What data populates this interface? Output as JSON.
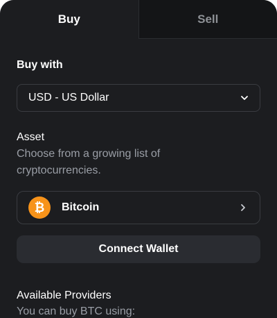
{
  "tabs": {
    "buy": "Buy",
    "sell": "Sell",
    "active": "buy"
  },
  "buy_with": {
    "label": "Buy with",
    "selected": "USD - US Dollar",
    "chevron_icon": "chevron-down-icon"
  },
  "asset": {
    "heading": "Asset",
    "description": "Choose from a growing list of cryptocurrencies.",
    "selected_name": "Bitcoin",
    "coin_icon": "bitcoin-icon",
    "coin_symbol": "₿",
    "coin_color": "#f7931a",
    "chevron_icon": "chevron-right-icon"
  },
  "connect_wallet": {
    "label": "Connect Wallet"
  },
  "providers": {
    "heading": "Available Providers",
    "description": "You can buy BTC using:"
  },
  "colors": {
    "background": "#1c1d20",
    "inactive_tab": "#141517",
    "border": "#3a3c41",
    "button": "#2a2c31",
    "muted_text": "#9a9ea6"
  }
}
